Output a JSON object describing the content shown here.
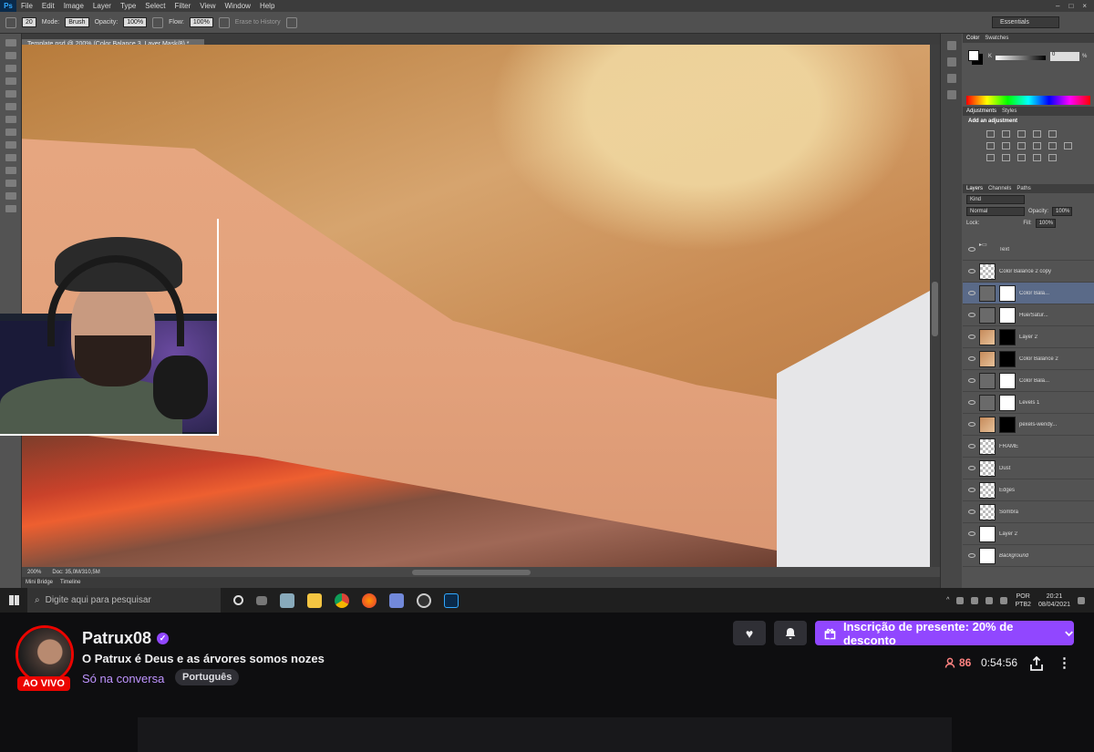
{
  "photoshop": {
    "app_logo": "Ps",
    "menu": [
      "File",
      "Edit",
      "Image",
      "Layer",
      "Type",
      "Select",
      "Filter",
      "View",
      "Window",
      "Help"
    ],
    "options": {
      "brush_size": "20",
      "mode_label": "Mode:",
      "mode_value": "Brush",
      "opacity_label": "Opacity:",
      "opacity_value": "100%",
      "flow_label": "Flow:",
      "flow_value": "100%",
      "erase_history": "Erase to History",
      "workspace": "Essentials"
    },
    "document_tab": "Template.psd @ 200% (Color Balance 3, Layer Mask/8) *",
    "status": {
      "zoom": "200%",
      "doc": "Doc: 35,0M/310,5M"
    },
    "bottom_tabs": [
      "Mini Bridge",
      "Timeline"
    ],
    "color_panel": {
      "tabs": [
        "Color",
        "Swatches"
      ],
      "channel": "K",
      "value": "0",
      "unit": "%"
    },
    "adjustments_panel": {
      "tabs": [
        "Adjustments",
        "Styles"
      ],
      "heading": "Add an adjustment"
    },
    "layers_panel": {
      "tabs": [
        "Layers",
        "Channels",
        "Paths"
      ],
      "filter": "Kind",
      "blend_mode": "Normal",
      "opacity_label": "Opacity:",
      "opacity_value": "100%",
      "lock_label": "Lock:",
      "fill_label": "Fill:",
      "fill_value": "100%",
      "layers": [
        {
          "name": "Text",
          "thumb": "folder",
          "mask": "none",
          "selected": false
        },
        {
          "name": "Color Balance 2 copy",
          "thumb": "checker",
          "mask": "none",
          "selected": false
        },
        {
          "name": "Color Bala...",
          "thumb": "adjust",
          "mask": "white",
          "selected": true
        },
        {
          "name": "Hue/Satur...",
          "thumb": "adjust",
          "mask": "white",
          "selected": false
        },
        {
          "name": "Layer 2",
          "thumb": "photo",
          "mask": "black",
          "selected": false
        },
        {
          "name": "Color Balance 2",
          "thumb": "photo",
          "mask": "black",
          "selected": false
        },
        {
          "name": "Color Bala...",
          "thumb": "adjust",
          "mask": "white",
          "selected": false
        },
        {
          "name": "Levels 1",
          "thumb": "adjust",
          "mask": "white",
          "selected": false
        },
        {
          "name": "pexels-wendy...",
          "thumb": "photo",
          "mask": "black",
          "selected": false
        },
        {
          "name": "FRAME",
          "thumb": "checker",
          "mask": "none",
          "selected": false
        },
        {
          "name": "Dust",
          "thumb": "checker",
          "mask": "none",
          "selected": false
        },
        {
          "name": "Edges",
          "thumb": "checker",
          "mask": "none",
          "selected": false
        },
        {
          "name": "Sombra",
          "thumb": "checker",
          "mask": "none",
          "selected": false
        },
        {
          "name": "Layer 2",
          "thumb": "white",
          "mask": "none",
          "selected": false
        },
        {
          "name": "Background",
          "thumb": "white",
          "mask": "none",
          "selected": false
        }
      ]
    }
  },
  "taskbar": {
    "search_placeholder": "Digite aqui para pesquisar",
    "lang_top": "POR",
    "lang_bottom": "PTB2",
    "time": "20:21",
    "date": "08/04/2021"
  },
  "twitch": {
    "channel_name": "Patrux08",
    "live_label": "AO VIVO",
    "stream_title": "O Patrux é Deus e as árvores somos nozes",
    "category": "Só na conversa",
    "tag": "Português",
    "gift_label": "Inscrição de presente: 20% de desconto",
    "viewers": "86",
    "uptime": "0:54:56",
    "colors": {
      "accent": "#9147ff",
      "live": "#eb0400",
      "viewers": "#ff8280"
    }
  }
}
